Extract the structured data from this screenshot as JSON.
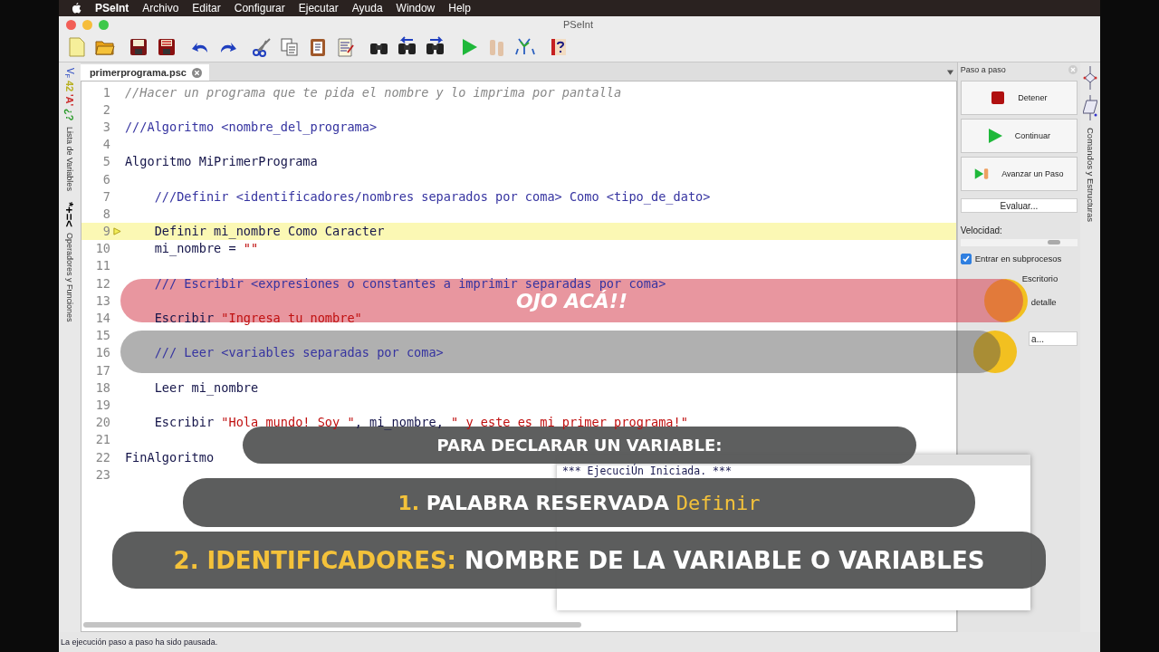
{
  "menu_bar": {
    "app": "PSeInt",
    "items": [
      "Archivo",
      "Editar",
      "Configurar",
      "Ejecutar",
      "Ayuda",
      "Window",
      "Help"
    ]
  },
  "window": {
    "title": "PSeInt"
  },
  "tabs": [
    {
      "label": "primerprograma.psc",
      "selected": true
    }
  ],
  "left_strip": {
    "logic": [
      "V",
      "F"
    ],
    "symbols": [
      "42",
      "'A'",
      "¿?"
    ],
    "variables_label": "Lista de Variables",
    "operators": "*+=<",
    "operators_label": "Operadores y Funciones"
  },
  "editor": {
    "lines": [
      {
        "number": "1",
        "current": false,
        "segments": [
          {
            "kind": "comment",
            "text": "//Hacer un programa que te pida el nombre y lo imprima por pantalla"
          }
        ]
      },
      {
        "number": "2",
        "current": false
      },
      {
        "number": "3",
        "current": false,
        "segments": [
          {
            "kind": "doc",
            "text": "///Algoritmo <nombre_del_programa>"
          }
        ]
      },
      {
        "number": "4",
        "current": false
      },
      {
        "number": "5",
        "current": false,
        "segments": [
          {
            "kind": "keyword",
            "text": "Algoritmo MiPrimerPrograma"
          }
        ]
      },
      {
        "number": "6",
        "current": false
      },
      {
        "number": "7",
        "current": false,
        "segments": [
          {
            "kind": "doc",
            "text": "    ///Definir <identificadores/nombres separados por coma> Como <tipo_de_dato>"
          }
        ]
      },
      {
        "number": "8",
        "current": false
      },
      {
        "number": "9",
        "current": true,
        "segments": [
          {
            "kind": "keyword",
            "text": "    Definir mi_nombre Como Caracter"
          }
        ]
      },
      {
        "number": "10",
        "current": false,
        "segments": [
          {
            "kind": "keyword",
            "text": "    mi_nombre = "
          },
          {
            "kind": "string",
            "text": "\"\""
          }
        ]
      },
      {
        "number": "11",
        "current": false
      },
      {
        "number": "12",
        "current": false,
        "segments": [
          {
            "kind": "doc",
            "text": "    /// Escribir <expresiones o constantes a imprimir separadas por coma>"
          }
        ]
      },
      {
        "number": "13",
        "current": false
      },
      {
        "number": "14",
        "current": false,
        "segments": [
          {
            "kind": "keyword",
            "text": "    Escribir "
          },
          {
            "kind": "string",
            "text": "\"Ingresa tu nombre\""
          }
        ]
      },
      {
        "number": "15",
        "current": false
      },
      {
        "number": "16",
        "current": false,
        "segments": [
          {
            "kind": "doc",
            "text": "    /// Leer <variables separadas por coma>"
          }
        ]
      },
      {
        "number": "17",
        "current": false
      },
      {
        "number": "18",
        "current": false,
        "segments": [
          {
            "kind": "keyword",
            "text": "    Leer mi_nombre"
          }
        ]
      },
      {
        "number": "19",
        "current": false
      },
      {
        "number": "20",
        "current": false,
        "segments": [
          {
            "kind": "keyword",
            "text": "    Escribir "
          },
          {
            "kind": "string",
            "text": "\"Hola mundo! Soy \""
          },
          {
            "kind": "keyword",
            "text": ", mi_nombre, "
          },
          {
            "kind": "string",
            "text": "\" y este es mi primer programa!\""
          }
        ]
      },
      {
        "number": "21",
        "current": false
      },
      {
        "number": "22",
        "current": false,
        "segments": [
          {
            "kind": "keyword",
            "text": "FinAlgoritmo"
          }
        ]
      },
      {
        "number": "23",
        "current": false
      }
    ]
  },
  "console": {
    "text": "*** EjecuciÚn Iniciada. ***"
  },
  "step_panel": {
    "title": "Paso a paso",
    "buttons": [
      {
        "kind": "stop",
        "label": "Detener"
      },
      {
        "kind": "play",
        "label": "Continuar"
      },
      {
        "kind": "step",
        "label": "Avanzar un Paso"
      }
    ],
    "evaluate": "Evaluar...",
    "speed_label": "Velocidad:",
    "speed": {
      "level": 0.85
    },
    "options": [
      {
        "label": "Entrar en subprocesos",
        "checked": true
      },
      {
        "label": "Escritorio"
      },
      {
        "label": "detalle"
      }
    ],
    "last_button": "a..."
  },
  "right_strip": {
    "label": "Comandos y Estructuras"
  },
  "status_bar": "La ejecución paso a paso ha sido pausada.",
  "overlays": [
    {
      "kind": "alert",
      "segments": [
        {
          "kind": "plain",
          "text": "OJO ACÁ!!"
        }
      ]
    },
    {
      "kind": "blank"
    },
    {
      "kind": "caption",
      "segments": [
        {
          "kind": "plain",
          "text": "PARA DECLARAR UN VARIABLE:"
        }
      ]
    },
    {
      "kind": "step1",
      "segments": [
        {
          "kind": "accent",
          "text": "1."
        },
        {
          "kind": "plain",
          "text": " PALABRA RESERVADA "
        },
        {
          "kind": "code",
          "text": "Definir"
        }
      ]
    },
    {
      "kind": "step2",
      "segments": [
        {
          "kind": "accent",
          "text": "2. IDENTIFICADORES:"
        },
        {
          "kind": "plain",
          "text": " NOMBRE DE LA VARIABLE O VARIABLES"
        }
      ]
    }
  ]
}
